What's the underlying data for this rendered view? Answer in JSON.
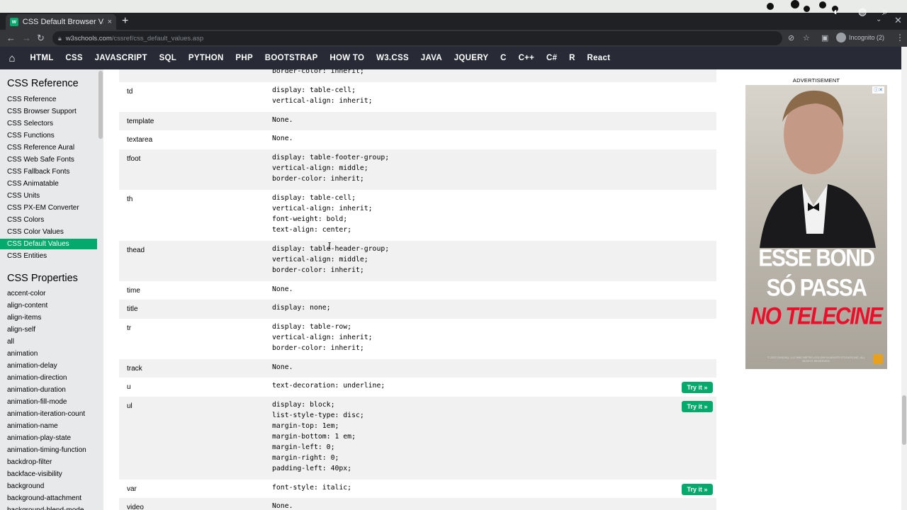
{
  "browser": {
    "tab_title": "CSS Default Browser Valu",
    "tab_close": "×",
    "new_tab": "+",
    "url_host": "w3schools.com",
    "url_path": "/cssref/css_default_values.asp",
    "profile_label": "Incognito (2)"
  },
  "topnav": {
    "items": [
      "HTML",
      "CSS",
      "JAVASCRIPT",
      "SQL",
      "PYTHON",
      "PHP",
      "BOOTSTRAP",
      "HOW TO",
      "W3.CSS",
      "JAVA",
      "JQUERY",
      "C",
      "C++",
      "C#",
      "R",
      "React"
    ]
  },
  "sidebar": {
    "heading_reference": "CSS Reference",
    "reference_links": [
      "CSS Reference",
      "CSS Browser Support",
      "CSS Selectors",
      "CSS Functions",
      "CSS Reference Aural",
      "CSS Web Safe Fonts",
      "CSS Fallback Fonts",
      "CSS Animatable",
      "CSS Units",
      "CSS PX-EM Converter",
      "CSS Colors",
      "CSS Color Values",
      "CSS Default Values",
      "CSS Entities"
    ],
    "active_link": "CSS Default Values",
    "heading_properties": "CSS Properties",
    "property_links": [
      "accent-color",
      "align-content",
      "align-items",
      "align-self",
      "all",
      "animation",
      "animation-delay",
      "animation-direction",
      "animation-duration",
      "animation-fill-mode",
      "animation-iteration-count",
      "animation-name",
      "animation-play-state",
      "animation-timing-function",
      "backdrop-filter",
      "backface-visibility",
      "background",
      "background-attachment",
      "background-blend-mode"
    ]
  },
  "table": {
    "rows": [
      {
        "element": "",
        "value": "border-color: inherit;",
        "try": false
      },
      {
        "element": "td",
        "value": "display: table-cell;\nvertical-align: inherit;",
        "try": false
      },
      {
        "element": "template",
        "value": "None.",
        "try": false
      },
      {
        "element": "textarea",
        "value": "None.",
        "try": false
      },
      {
        "element": "tfoot",
        "value": "display: table-footer-group;\nvertical-align: middle;\nborder-color: inherit;",
        "try": false
      },
      {
        "element": "th",
        "value": "display: table-cell;\nvertical-align: inherit;\nfont-weight: bold;\ntext-align: center;",
        "try": false
      },
      {
        "element": "thead",
        "value": "display: table-header-group;\nvertical-align: middle;\nborder-color: inherit;",
        "try": false
      },
      {
        "element": "time",
        "value": "None.",
        "try": false
      },
      {
        "element": "title",
        "value": "display: none;",
        "try": false
      },
      {
        "element": "tr",
        "value": "display: table-row;\nvertical-align: inherit;\nborder-color: inherit;",
        "try": false
      },
      {
        "element": "track",
        "value": "None.",
        "try": false
      },
      {
        "element": "u",
        "value": "text-decoration: underline;",
        "try": true
      },
      {
        "element": "ul",
        "value": "display: block;\nlist-style-type: disc;\nmargin-top: 1em;\nmargin-bottom: 1 em;\nmargin-left: 0;\nmargin-right: 0;\npadding-left: 40px;",
        "try": true
      },
      {
        "element": "var",
        "value": "font-style: italic;",
        "try": true
      },
      {
        "element": "video",
        "value": "None.",
        "try": false
      }
    ],
    "try_label": "Try it »"
  },
  "ad": {
    "label": "ADVERTISEMENT",
    "headline_1": "ESSE BOND",
    "headline_2": "SÓ PASSA",
    "headline_3": "NO TELECINE",
    "credits": "© 2021 DANJAQ, LLC AND METRO-GOLDWYN-MAYER STUDIOS INC. ALL RIGHTS RESERVED."
  },
  "colors": {
    "accent": "#04aa6d",
    "nav_bg": "#282a35",
    "sidebar_bg": "#e7e9eb",
    "ad_red": "#e8102a"
  }
}
